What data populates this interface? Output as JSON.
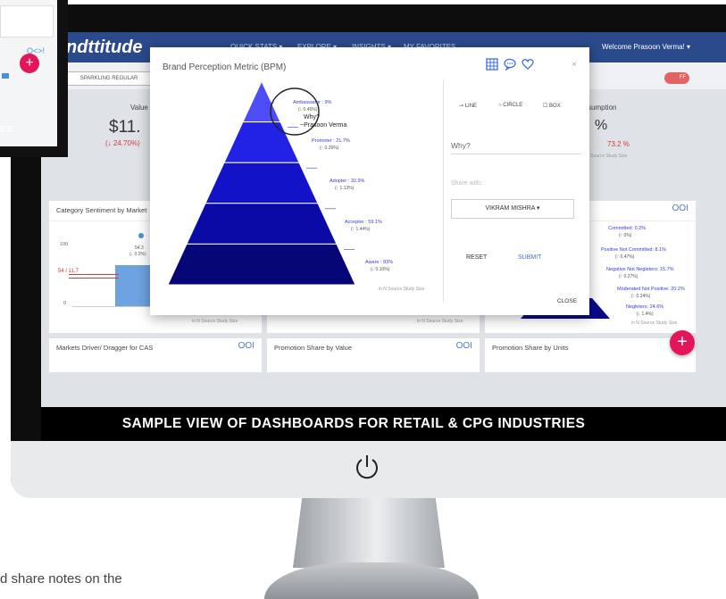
{
  "background_shot": {
    "section_title": "ES",
    "link_text": "O<>!",
    "fab_label": "+"
  },
  "dashboard": {
    "logo": "ndttitude",
    "nav": [
      "QUICK STATS ▾",
      "EXPLORE ▾",
      "INSIGHTS ▾",
      "MY FAVORITES"
    ],
    "welcome": "Welcome Prasoon Verma! ▾",
    "filter_chip": "SPARKLING REGULAR",
    "toggle_label": "FF",
    "kpis": {
      "value_label": "Value",
      "value": "$11.",
      "value_change": "(↓ 24.70%)",
      "consumption_label": "sumption",
      "consumption_value": "%",
      "consumption_change": "73.2 %",
      "consumption_tiny": "in Source Study Size"
    },
    "panels": [
      {
        "title": "Category Sentiment by Market",
        "icons": "OOI"
      },
      {
        "title": "Markets Driver/ Dragger for CAS",
        "icons": "OOI"
      },
      {
        "title": "Promotion Share by Value",
        "icons": "OOI"
      },
      {
        "title": "Promotion Share by Units",
        "icons": "OOI"
      }
    ],
    "sentiment_chart": {
      "y_ticks": [
        "100",
        "0"
      ],
      "bar_label": "54.3",
      "bar_sub": "(↓ 0.2%)",
      "left_marker": "54 / 11.7",
      "footnote": "in N Source Study Size"
    },
    "right_pyramid": [
      {
        "label": "Committed: 0.2%",
        "sub": "(↑ 0%)"
      },
      {
        "label": "Positive Not Committed: 8.1%",
        "sub": "(↑ 0.47%)"
      },
      {
        "label": "Negative Not Negleters: 15.7%",
        "sub": "(↑ 0.27%)"
      },
      {
        "label": "Moderated Not Positive: 20.2%",
        "sub": "(↑ 0.24%)"
      },
      {
        "label": "Negleters: 24.6%",
        "sub": "(↓ 1.4%)"
      }
    ],
    "right_pyramid_footnote": "in N Source Study Size",
    "fab_label": "+"
  },
  "modal": {
    "title": "Brand Perception Metric (BPM)",
    "icons": [
      "grid-icon",
      "comment-icon",
      "heart-icon"
    ],
    "close_x": "×",
    "chart_data": {
      "type": "pyramid",
      "levels": [
        {
          "name": "Ambassador",
          "value": 9.5,
          "change": "(↓ 0.45%)",
          "direction": "down",
          "color": "#4d4df5"
        },
        {
          "name": "Promoter",
          "value": 21.7,
          "change": "(↑ 0.26%)",
          "direction": "up",
          "color": "#2222e6"
        },
        {
          "name": "Adopter",
          "value": 32.9,
          "change": "(↑ 1.13%)",
          "direction": "up",
          "color": "#1212c9"
        },
        {
          "name": "Accepter",
          "value": 59.1,
          "change": "(↑ 1.44%)",
          "direction": "up",
          "color": "#0a0aa6"
        },
        {
          "name": "Aware",
          "value": 83,
          "change": "(↓ 0.10%)",
          "direction": "down",
          "color": "#060677"
        }
      ],
      "labels": [
        "Ambassador : 9%",
        "Promoter : 21.7%",
        "Adopter : 32.9%",
        "Accepter : 59.1%",
        "Aware : 83%"
      ],
      "footnote": "in N Source Study Size"
    },
    "annotation": {
      "line1": "Why?",
      "line2": "~Prasoon Verma"
    },
    "draw_options": [
      "⊸ LINE",
      "○ CIRCLE",
      "☐ BOX"
    ],
    "why_input": "Why?",
    "share_label": "Share with:",
    "share_select": "VIKRAM MISHRA ▾",
    "reset_label": "RESET",
    "submit_label": "SUBMIT",
    "close_label": "CLOSE"
  },
  "caption": "SAMPLE VIEW OF DASHBOARDS FOR RETAIL & CPG INDUSTRIES",
  "bottom_text": "d share notes on the",
  "colors": {
    "nav": "#2b4a8c",
    "fab": "#e3165b",
    "link": "#3e6fe0",
    "negative": "#d23b3b"
  }
}
